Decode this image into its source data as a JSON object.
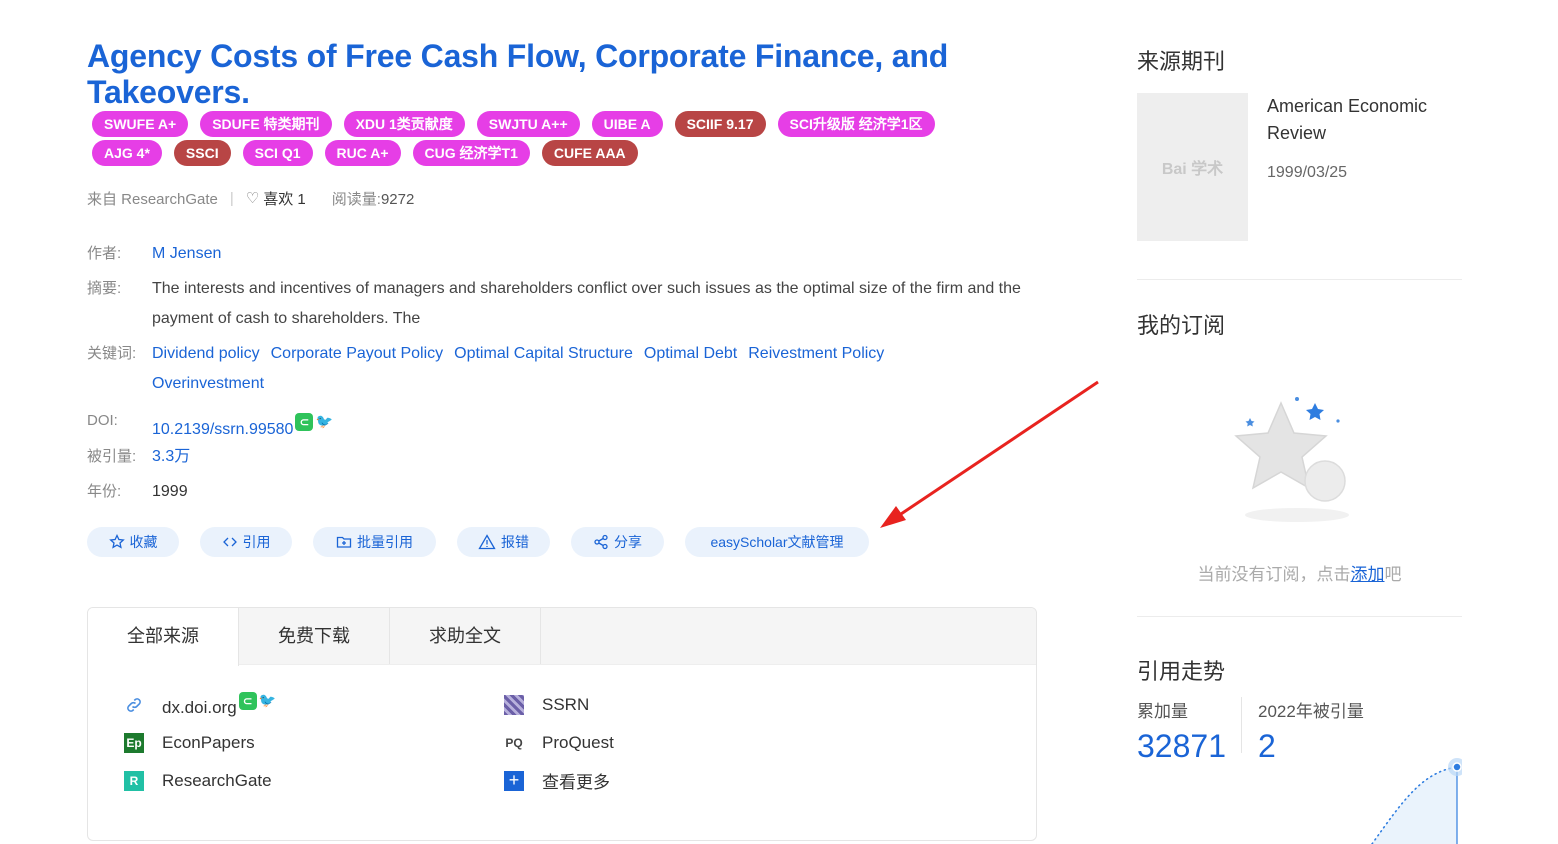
{
  "article": {
    "title": "Agency Costs of Free Cash Flow, Corporate Finance, and Takeovers.",
    "tags_row1": [
      {
        "text": "SWUFE A+",
        "color": "pink"
      },
      {
        "text": "SDUFE 特类期刊",
        "color": "pink"
      },
      {
        "text": "XDU 1类贡献度",
        "color": "pink"
      },
      {
        "text": "SWJTU A++",
        "color": "pink"
      },
      {
        "text": "UIBE A",
        "color": "pink"
      },
      {
        "text": "SCIIF 9.17",
        "color": "brown"
      },
      {
        "text": "SCI升级版 经济学1区",
        "color": "pink"
      }
    ],
    "tags_row2": [
      {
        "text": "AJG 4*",
        "color": "pink"
      },
      {
        "text": "SSCI",
        "color": "brown"
      },
      {
        "text": "SCI Q1",
        "color": "pink"
      },
      {
        "text": "RUC A+",
        "color": "pink"
      },
      {
        "text": "CUG 经济学T1",
        "color": "pink"
      },
      {
        "text": "CUFE AAA",
        "color": "brown"
      }
    ],
    "source_text": "来自 ResearchGate",
    "like_label": "喜欢 1",
    "views_label": "阅读量:",
    "views_value": "9272",
    "author_label": "作者:",
    "author": "M Jensen",
    "abstract_label": "摘要:",
    "abstract": "The interests and incentives of managers and shareholders conflict over such issues as the optimal size of the firm and the payment of cash to shareholders. The",
    "keywords_label": "关键词:",
    "keywords": [
      "Dividend policy",
      "Corporate Payout Policy",
      "Optimal Capital Structure",
      "Optimal Debt",
      "Reivestment Policy",
      "Overinvestment"
    ],
    "doi_label": "DOI:",
    "doi": "10.2139/ssrn.99580",
    "cited_label": "被引量:",
    "cited": "3.3万",
    "year_label": "年份:",
    "year": "1999"
  },
  "actions": [
    {
      "label": "收藏",
      "icon": "star-icon"
    },
    {
      "label": "引用",
      "icon": "code-icon"
    },
    {
      "label": "批量引用",
      "icon": "folder-plus-icon"
    },
    {
      "label": "报错",
      "icon": "warning-icon"
    },
    {
      "label": "分享",
      "icon": "share-icon"
    },
    {
      "label": "easyScholar文献管理",
      "icon": ""
    }
  ],
  "sources": {
    "tabs": [
      "全部来源",
      "免费下载",
      "求助全文"
    ],
    "items": [
      {
        "name": "dx.doi.org",
        "icon": "link-icon"
      },
      {
        "name": "SSRN",
        "icon": "ssrn-logo-icon"
      },
      {
        "name": "EconPapers",
        "icon": "econpapers-logo-icon"
      },
      {
        "name": "ProQuest",
        "icon": "proquest-logo-icon"
      },
      {
        "name": "ResearchGate",
        "icon": "researchgate-logo-icon"
      },
      {
        "name": "查看更多",
        "icon": "plus-icon"
      }
    ]
  },
  "sidebar": {
    "journal_heading": "来源期刊",
    "journal_name": "American Economic Review",
    "journal_date": "1999/03/25",
    "cover_text": "Bai 学术",
    "subscribe_heading": "我的订阅",
    "empty_prefix": "当前没有订阅，点击",
    "empty_link": "添加",
    "empty_suffix": "吧",
    "trend_heading": "引用走势",
    "cumulative_label": "累加量",
    "cumulative_value": "32871",
    "year_cited_label": "2022年被引量",
    "year_cited_value": "2"
  },
  "colors": {
    "link": "#1a64d6",
    "tag_pink": "#e63ee6",
    "tag_brown": "#b84545",
    "annotation_arrow": "#e8231f"
  }
}
